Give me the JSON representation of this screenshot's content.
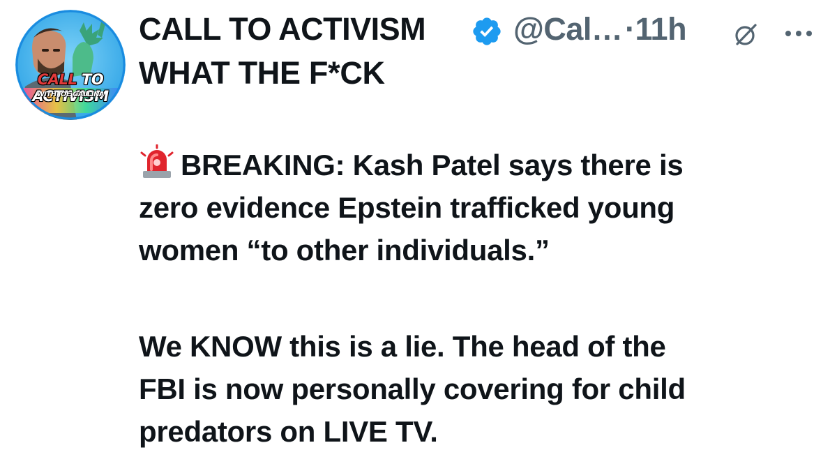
{
  "author": {
    "display_name": "CALL TO ACTIVISM",
    "handle": "@Cal…",
    "separator": "·",
    "time": "11h",
    "verified": true,
    "avatar": {
      "text_top_a": "CALL ",
      "text_top_b": "TO ACTIVISM",
      "text_bottom": "WITH JOE GALLINA",
      "ring_color": "#1a8be0"
    }
  },
  "icons": {
    "verified": "verified-badge-icon",
    "grok": "grok-icon",
    "more": "more-icon",
    "siren": "rotating-light-icon"
  },
  "post": {
    "line1": "WHAT THE F*CK",
    "para2": [
      "BREAKING: Kash Patel says there is",
      "zero evidence Epstein trafficked young",
      "women “to other individuals.”"
    ],
    "para3": [
      "We KNOW this is a lie. The head of the",
      "FBI is now personally covering for child",
      "predators on LIVE TV."
    ]
  },
  "colors": {
    "text": "#0f1419",
    "secondary": "#536471",
    "verified": "#1d9bf0",
    "siren": "#e0242d"
  }
}
